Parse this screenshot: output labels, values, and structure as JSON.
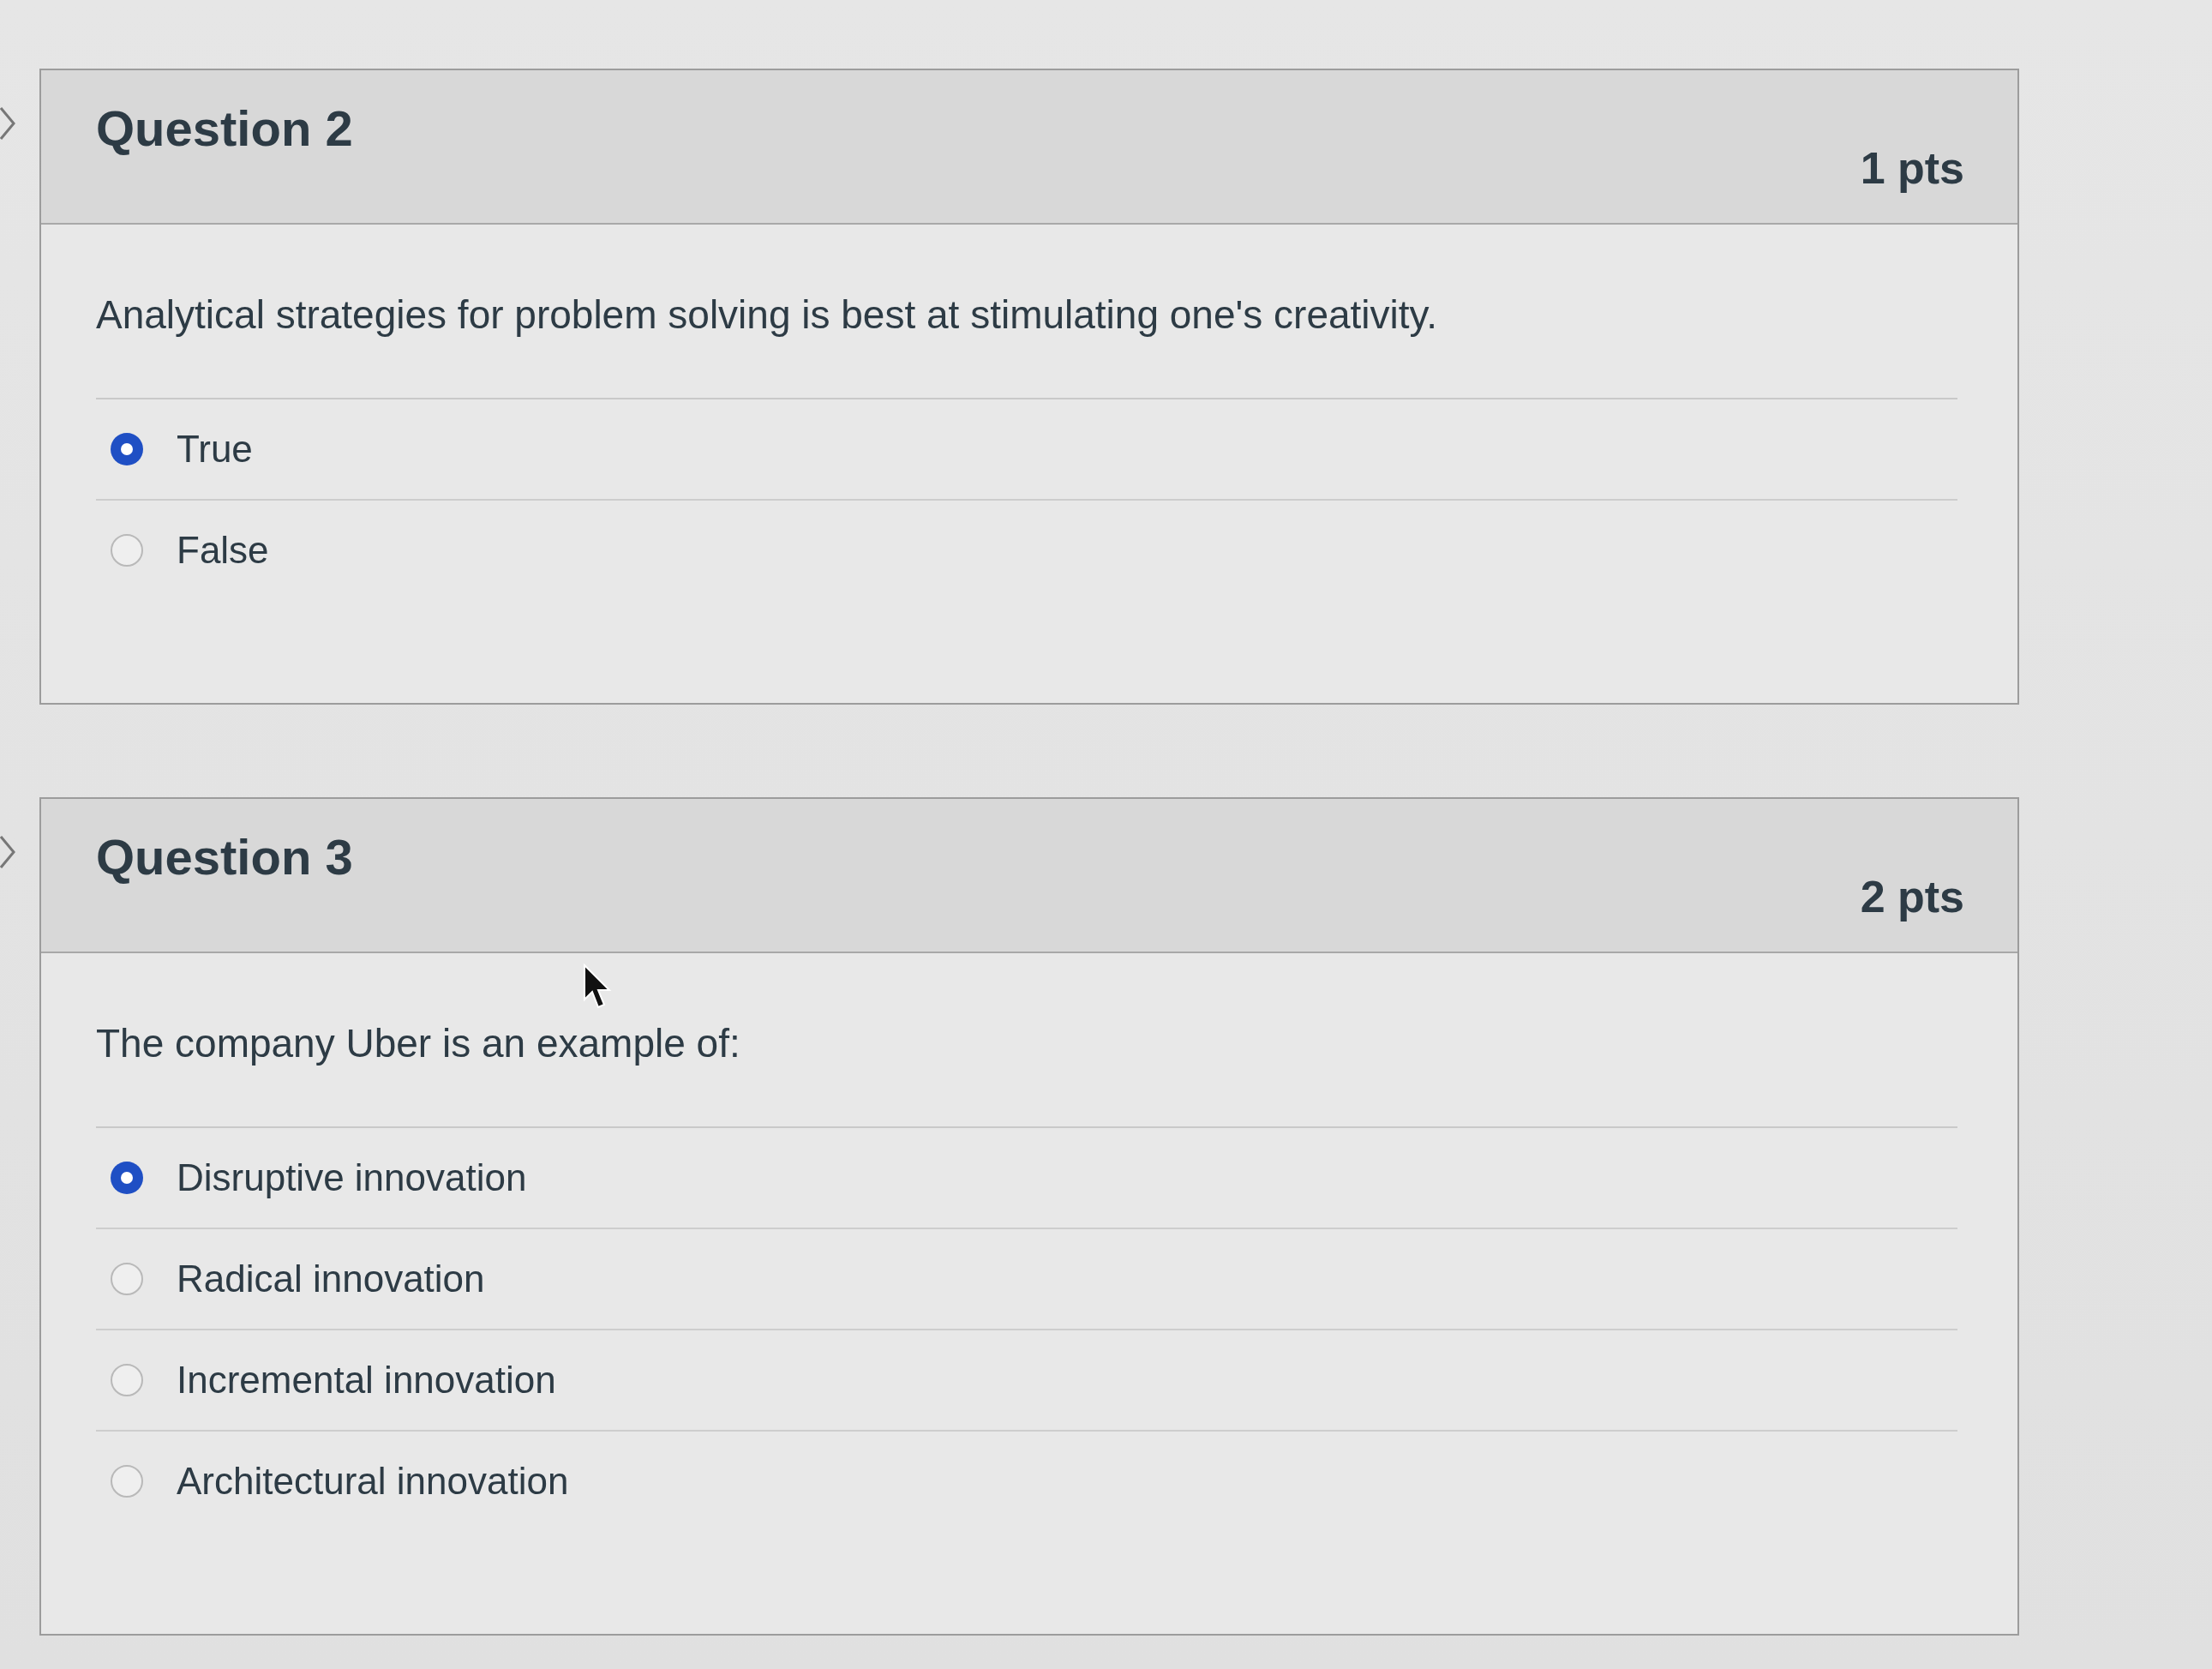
{
  "questions": [
    {
      "title": "Question 2",
      "points": "1 pts",
      "text": "Analytical strategies for problem solving is best at stimulating one's creativity.",
      "options": [
        {
          "label": "True",
          "selected": true
        },
        {
          "label": "False",
          "selected": false
        }
      ]
    },
    {
      "title": "Question 3",
      "points": "2 pts",
      "text": "The company Uber is an example of:",
      "options": [
        {
          "label": "Disruptive innovation",
          "selected": true
        },
        {
          "label": "Radical innovation",
          "selected": false
        },
        {
          "label": "Incremental innovation",
          "selected": false
        },
        {
          "label": "Architectural innovation",
          "selected": false
        }
      ]
    }
  ]
}
